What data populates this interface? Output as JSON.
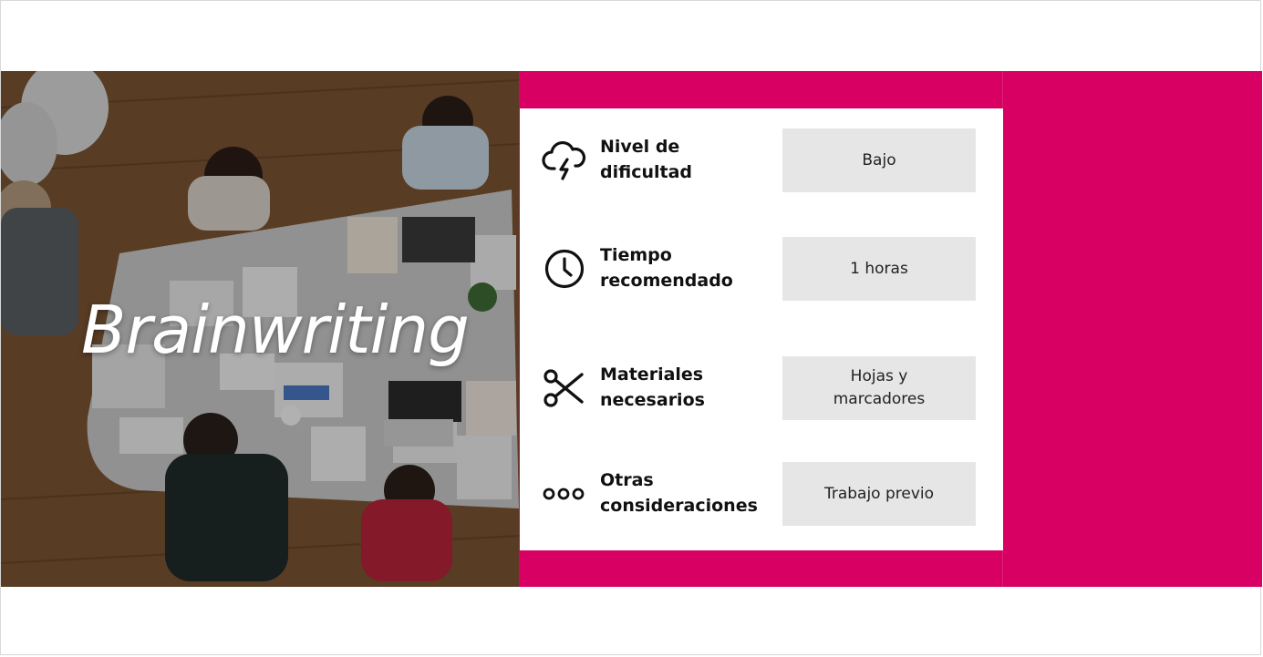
{
  "hero": {
    "title": "Brainwriting"
  },
  "rows": [
    {
      "icon": "storm-cloud-icon",
      "label": "Nivel de\n dificultad",
      "value": "Bajo"
    },
    {
      "icon": "clock-icon",
      "label": "Tiempo\nrecomendado",
      "value": "1 horas"
    },
    {
      "icon": "scissors-icon",
      "label": "Materiales\nnecesarios",
      "value": "Hojas y\nmarcadores"
    },
    {
      "icon": "more-dots-icon",
      "label": "Otras\nconsideraciones",
      "value": "Trabajo previo"
    }
  ],
  "colors": {
    "accent": "#d80062",
    "value_box": "#e6e6e6",
    "card": "#ffffff"
  }
}
